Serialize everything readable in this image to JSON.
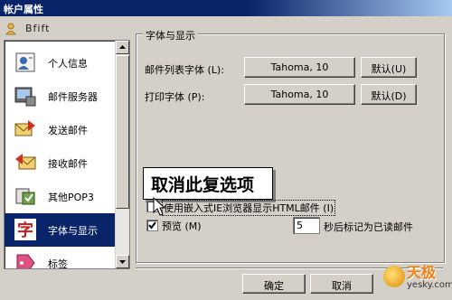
{
  "window": {
    "title": "帐户属性"
  },
  "account": {
    "name": "Bfift"
  },
  "sidebar": {
    "items": [
      {
        "label": "个人信息",
        "icon": "contact-card-icon"
      },
      {
        "label": "邮件服务器",
        "icon": "server-icon"
      },
      {
        "label": "发送邮件",
        "icon": "send-mail-icon"
      },
      {
        "label": "接收邮件",
        "icon": "receive-mail-icon"
      },
      {
        "label": "其他POP3",
        "icon": "pop3-icon"
      },
      {
        "label": "字体与显示",
        "icon": "font-icon",
        "selected": true
      },
      {
        "label": "标签",
        "icon": "tag-icon"
      }
    ]
  },
  "group": {
    "title": "字体与显示"
  },
  "rows": {
    "mail_list_font": {
      "label": "邮件列表字体 (L):",
      "value": "Tahoma, 10",
      "default_label": "默认(U)"
    },
    "print_font": {
      "label": "打印字体 (P):",
      "value": "Tahoma, 10",
      "default_label": "默认(D)"
    }
  },
  "callout": {
    "text": "取消此复选项"
  },
  "checkboxes": {
    "embed_ie": {
      "label": "使用嵌入式IE浏览器显示HTML邮件 (I)",
      "checked": false
    },
    "preview": {
      "label": "预览 (M)",
      "checked": true
    }
  },
  "mark_read": {
    "value": "5",
    "suffix": "秒后标记为已读邮件"
  },
  "buttons": {
    "ok": "确定",
    "cancel": "取消"
  },
  "watermark": {
    "brand": "天极",
    "site": "yesky.com"
  }
}
